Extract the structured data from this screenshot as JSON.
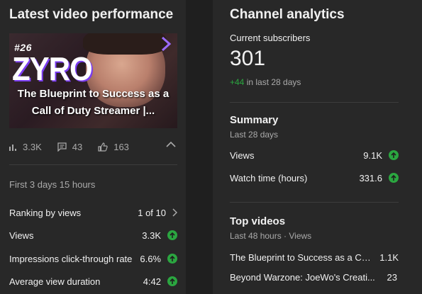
{
  "left_card": {
    "title": "Latest video performance",
    "thumbnail": {
      "episode": "#26",
      "brand": "ZYRO",
      "caption": "The Blueprint to Success as a Call of Duty Streamer |..."
    },
    "stats": {
      "views": "3.3K",
      "comments": "43",
      "likes": "163"
    },
    "period": "First 3 days 15 hours",
    "rows": [
      {
        "label": "Ranking by views",
        "value": "1 of 10"
      },
      {
        "label": "Views",
        "value": "3.3K"
      },
      {
        "label": "Impressions click-through rate",
        "value": "6.6%"
      },
      {
        "label": "Average view duration",
        "value": "4:42"
      }
    ]
  },
  "right_card": {
    "title": "Channel analytics",
    "subscribers_label": "Current subscribers",
    "subscribers": "301",
    "subscribers_delta": "+44",
    "subscribers_delta_suffix": " in last 28 days",
    "summary": {
      "heading": "Summary",
      "period": "Last 28 days",
      "rows": [
        {
          "label": "Views",
          "value": "9.1K"
        },
        {
          "label": "Watch time (hours)",
          "value": "331.6"
        }
      ]
    },
    "top_videos": {
      "heading": "Top videos",
      "period": "Last 48 hours · Views",
      "rows": [
        {
          "label": "The Blueprint to Success as a Cal...",
          "value": "1.1K"
        },
        {
          "label": "Beyond Warzone: JoeWo's Creati...",
          "value": "23"
        }
      ]
    }
  },
  "colors": {
    "background": "#1f1f1f",
    "card": "#282828",
    "positive": "#2ba640",
    "muted_text": "#aaaaaa",
    "thumbnail_accent": "#7b3df0"
  },
  "icons": [
    "bar-chart-icon",
    "comment-icon",
    "thumbs-up-icon",
    "chevron-up-icon",
    "chevron-right-icon",
    "arrow-up-icon"
  ]
}
